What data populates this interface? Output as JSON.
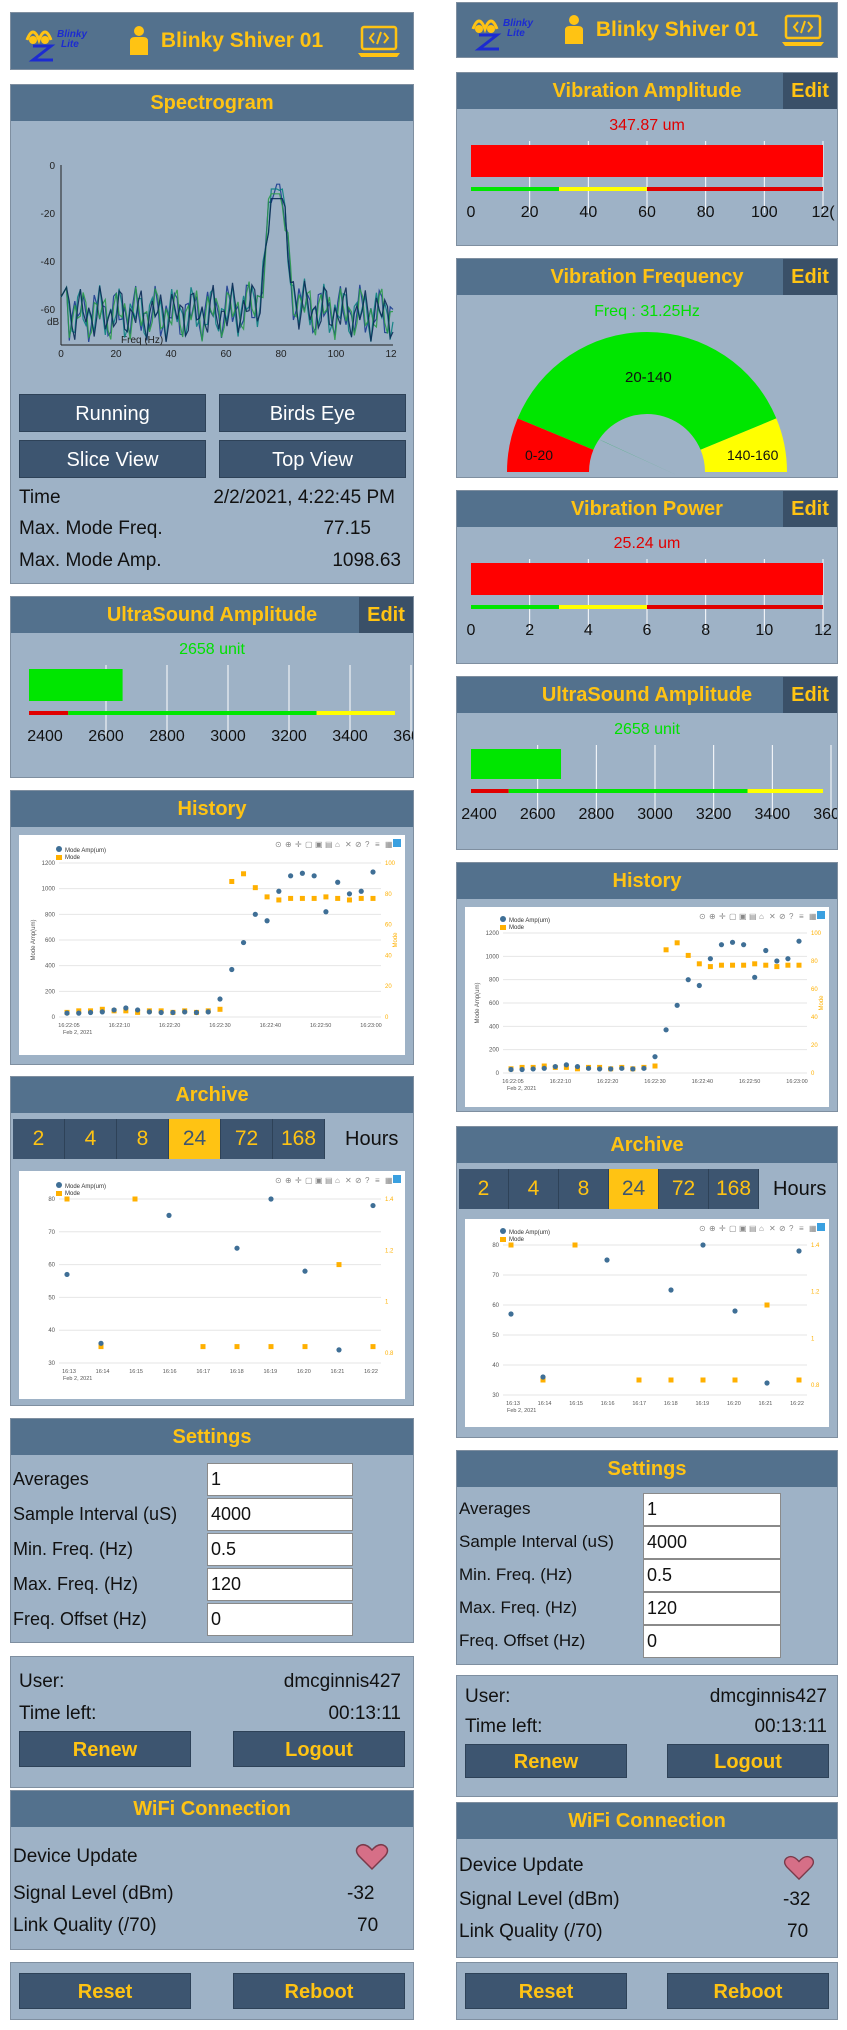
{
  "app": {
    "brand": "Blinky",
    "brand_sub": "Lite",
    "device_name": "Blinky Shiver 01"
  },
  "spectrogram": {
    "title": "Spectrogram",
    "y_label": "dB",
    "x_label": "Freq (Hz)",
    "y_ticks": [
      "0",
      "-20",
      "-40",
      "-60"
    ],
    "x_ticks": [
      "0",
      "20",
      "40",
      "60",
      "80",
      "100",
      "12"
    ],
    "buttons": [
      "Running",
      "Birds Eye",
      "Slice View",
      "Top View"
    ],
    "time_label": "Time",
    "time_value": "2/2/2021, 4:22:45 PM",
    "max_freq_label": "Max. Mode Freq.",
    "max_freq_value": "77.15",
    "max_amp_label": "Max. Mode Amp.",
    "max_amp_value": "1098.63"
  },
  "ultrasound": {
    "title": "UltraSound Amplitude",
    "edit": "Edit",
    "value": "2658 unit",
    "ticks": [
      "2400",
      "2600",
      "2800",
      "3000",
      "3200",
      "3400",
      "3600"
    ],
    "range": [
      2300,
      3700
    ],
    "reading": 2658,
    "red_to": 2450,
    "green_to": 3400
  },
  "history": {
    "title": "History",
    "legend": [
      "Mode Amp(um)",
      "Mode"
    ],
    "y_left_label": "Mode Amp(um)",
    "y_right_label": "Mode",
    "y_left_ticks": [
      "0",
      "200",
      "400",
      "600",
      "800",
      "1000",
      "1200"
    ],
    "y_right_ticks": [
      "0",
      "20",
      "40",
      "60",
      "80",
      "100"
    ],
    "x_ticks": [
      "16:22:05",
      "16:22:10",
      "16:22:20",
      "16:22:30",
      "16:22:40",
      "16:22:50",
      "16:23:00"
    ],
    "x_sub": "Feb 2, 2021",
    "amp": [
      30,
      30,
      35,
      40,
      55,
      70,
      55,
      40,
      35,
      35,
      40,
      35,
      40,
      140,
      370,
      580,
      800,
      750,
      980,
      1100,
      1120,
      1100,
      820,
      1050,
      960,
      980,
      1130
    ],
    "mode": [
      3,
      4,
      4,
      5,
      4,
      4,
      3,
      4,
      4,
      3,
      4,
      3,
      4,
      5,
      88,
      93,
      84,
      78,
      76,
      77,
      77,
      77,
      78,
      77,
      76,
      77,
      77
    ]
  },
  "archive": {
    "title": "Archive",
    "tabs": [
      "2",
      "4",
      "8",
      "24",
      "72",
      "168"
    ],
    "active_tab": "24",
    "hours_label": "Hours",
    "legend": [
      "Mode Amp(um)",
      "Mode"
    ],
    "y_left_ticks": [
      "30",
      "40",
      "50",
      "60",
      "70",
      "80"
    ],
    "y_right_ticks": [
      "0.8",
      "1",
      "1.2",
      "1.4"
    ],
    "x_ticks": [
      "16:13",
      "16:14",
      "16:15",
      "16:16",
      "16:17",
      "16:18",
      "16:19",
      "16:20",
      "16:21",
      "16:22"
    ],
    "x_sub": "Feb 2, 2021",
    "amp": [
      57,
      36,
      null,
      75,
      null,
      65,
      80,
      58,
      34,
      78
    ],
    "mode": [
      1.5,
      0.6,
      1.5,
      null,
      0.6,
      0.6,
      0.6,
      0.6,
      1.1,
      0.6
    ]
  },
  "settings": {
    "title": "Settings",
    "fields": [
      {
        "label": "Averages",
        "value": "1"
      },
      {
        "label": "Sample Interval (uS)",
        "value": "4000"
      },
      {
        "label": "Min. Freq. (Hz)",
        "value": "0.5"
      },
      {
        "label": "Max. Freq. (Hz)",
        "value": "120"
      },
      {
        "label": "Freq. Offset (Hz)",
        "value": "0"
      }
    ]
  },
  "session": {
    "user_label": "User:",
    "user_value": "dmcginnis427",
    "time_label": "Time left:",
    "time_value": "00:13:11",
    "renew": "Renew",
    "logout": "Logout"
  },
  "wifi": {
    "title": "WiFi Connection",
    "update_label": "Device Update",
    "signal_label": "Signal Level (dBm)",
    "signal_value": "-32",
    "link_label": "Link Quality (/70)",
    "link_value": "70"
  },
  "footer": {
    "reset": "Reset",
    "reboot": "Reboot"
  },
  "vib_amp": {
    "title": "Vibration Amplitude",
    "edit": "Edit",
    "value": "347.87 um",
    "ticks": [
      "0",
      "20",
      "40",
      "60",
      "80",
      "100",
      "12("
    ],
    "range": [
      0,
      120
    ],
    "reading": 120
  },
  "vib_freq": {
    "title": "Vibration Frequency",
    "edit": "Edit",
    "value": "Freq : 31.25Hz",
    "zones": [
      "0-20",
      "20-140",
      "140-160"
    ],
    "reading": 31.25,
    "max": 160
  },
  "vib_power": {
    "title": "Vibration Power",
    "edit": "Edit",
    "value": "25.24 um",
    "ticks": [
      "0",
      "2",
      "4",
      "6",
      "8",
      "10",
      "12"
    ],
    "range": [
      0,
      12
    ],
    "reading": 12
  },
  "colors": {
    "header_bg": "#53718d",
    "accent": "#ffc313",
    "panel_bg": "#9eb2c6",
    "button_bg": "#3d5570",
    "red": "#ff0000",
    "green": "#00e600",
    "yellow": "#ffff00",
    "amp_dot": "#3f6f96",
    "mode_dot": "#ffb000"
  }
}
